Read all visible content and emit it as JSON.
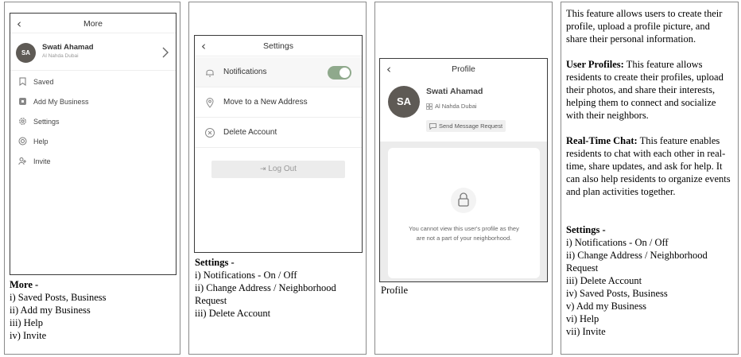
{
  "more": {
    "title": "More",
    "back_icon": "‹",
    "user_initials": "SA",
    "user_name": "Swati Ahamad",
    "user_location": "Al Nahda Dubai",
    "items": [
      {
        "label": "Saved",
        "icon": "bookmark-icon"
      },
      {
        "label": "Add My Business",
        "icon": "business-icon"
      },
      {
        "label": "Help",
        "icon": "help-icon"
      },
      {
        "label": "Invite",
        "icon": "invite-icon"
      }
    ],
    "settings_label": "Settings",
    "caption_title": "More -",
    "caption_lines": [
      "i) Saved Posts, Business",
      "ii) Add my Business",
      "iii) Help",
      "iv) Invite"
    ]
  },
  "settings": {
    "title": "Settings",
    "notifications_label": "Notifications",
    "notifications_on": true,
    "move_label": "Move to a New Address",
    "delete_label": "Delete Account",
    "logout_label": "Log Out",
    "caption_title": "Settings -",
    "caption_lines": [
      "i) Notifications - On / Off",
      "ii) Change Address / Neighborhood",
      "Request",
      "iii) Delete Account"
    ]
  },
  "profile": {
    "title": "Profile",
    "user_initials": "SA",
    "user_name": "Swati Ahamad",
    "user_location": "Al Nahda Dubai",
    "send_message_label": "Send Message Request",
    "locked_message_line1": "You cannot view this user's profile as they",
    "locked_message_line2": "are not a part of your neighborhood.",
    "caption": "Profile"
  },
  "description": {
    "intro": "This feature allows users to create their profile, upload a profile picture, and share their personal information.",
    "user_profiles_title": "User Profiles:",
    "user_profiles_text": " This feature allows residents to create their profiles, upload their photos, and share their interests, helping them to connect and socialize with their neighbors.",
    "chat_title": "Real-Time Chat:",
    "chat_text": " This feature enables residents to chat with each other in real-time, share updates, and ask for help. It can also help residents to organize events and plan activities together.",
    "settings_title": "Settings -",
    "settings_lines": [
      "i) Notifications - On / Off",
      "ii) Change Address / Neighborhood",
      "Request",
      "iii) Delete Account",
      "iv) Saved Posts, Business",
      "v) Add my Business",
      "vi) Help",
      "vii) Invite"
    ]
  },
  "colors": {
    "avatar": "#5e5a55",
    "toggle_on": "#8fa98c",
    "bg_grey": "#ececec"
  }
}
